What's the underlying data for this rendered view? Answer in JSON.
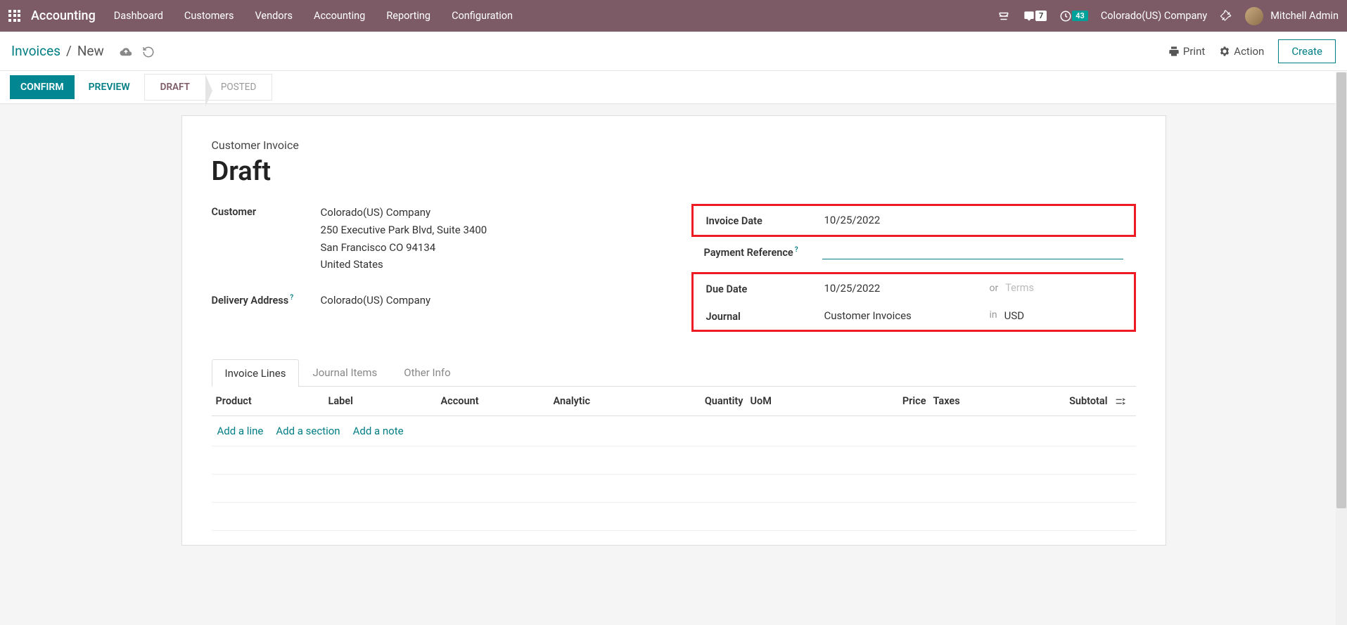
{
  "navbar": {
    "app_title": "Accounting",
    "menu": [
      "Dashboard",
      "Customers",
      "Vendors",
      "Accounting",
      "Reporting",
      "Configuration"
    ],
    "chat_badge": "7",
    "clock_badge": "43",
    "company": "Colorado(US) Company",
    "user": "Mitchell Admin"
  },
  "breadcrumb": {
    "parent": "Invoices",
    "current": "New",
    "print": "Print",
    "action": "Action",
    "create": "Create"
  },
  "status": {
    "confirm": "CONFIRM",
    "preview": "PREVIEW",
    "draft": "DRAFT",
    "posted": "POSTED"
  },
  "form": {
    "doc_type": "Customer Invoice",
    "title": "Draft",
    "customer_label": "Customer",
    "customer_name": "Colorado(US) Company",
    "customer_addr1": "250 Executive Park Blvd, Suite 3400",
    "customer_addr2": "San Francisco CO 94134",
    "customer_addr3": "United States",
    "delivery_label": "Delivery Address",
    "delivery_value": "Colorado(US) Company",
    "invoice_date_label": "Invoice Date",
    "invoice_date": "10/25/2022",
    "payment_ref_label": "Payment Reference",
    "payment_ref": "",
    "due_date_label": "Due Date",
    "due_date": "10/25/2022",
    "or_text": "or",
    "terms_placeholder": "Terms",
    "journal_label": "Journal",
    "journal": "Customer Invoices",
    "in_text": "in",
    "currency": "USD"
  },
  "tabs": {
    "lines": "Invoice Lines",
    "journal_items": "Journal Items",
    "other": "Other Info"
  },
  "columns": {
    "product": "Product",
    "label": "Label",
    "account": "Account",
    "analytic": "Analytic",
    "quantity": "Quantity",
    "uom": "UoM",
    "price": "Price",
    "taxes": "Taxes",
    "subtotal": "Subtotal"
  },
  "add": {
    "line": "Add a line",
    "section": "Add a section",
    "note": "Add a note"
  }
}
